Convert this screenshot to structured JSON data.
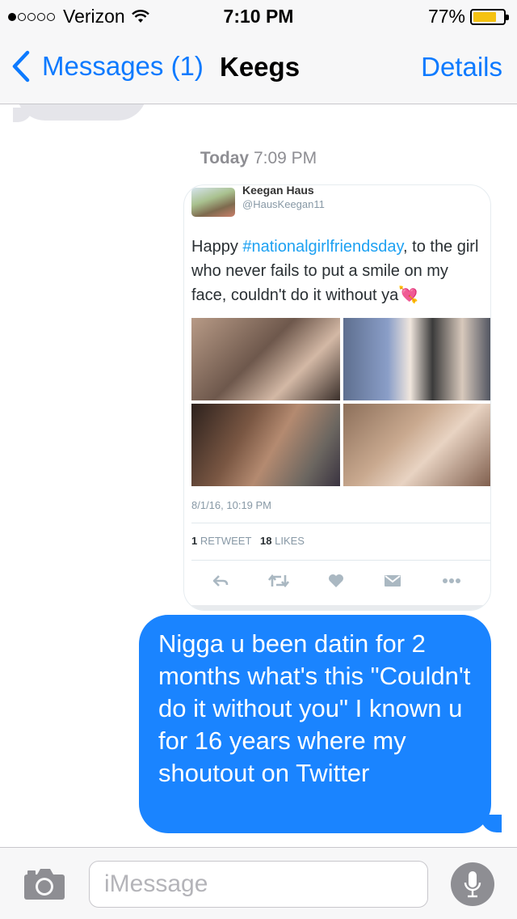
{
  "status_bar": {
    "signal_filled": 1,
    "signal_total": 5,
    "carrier": "Verizon",
    "time": "7:10 PM",
    "battery_percent": "77%",
    "battery_level": 0.77,
    "battery_color": "#f5c211"
  },
  "nav": {
    "back_label": "Messages (1)",
    "title": "Keegs",
    "details_label": "Details",
    "accent_color": "#0d7aff"
  },
  "conversation": {
    "timestamp_day": "Today",
    "timestamp_time": "7:09 PM",
    "tweet": {
      "name": "Keegan Haus",
      "handle": "@HausKeegan11",
      "text_before": "Happy ",
      "hashtag": "#nationalgirlfriendsday",
      "text_after": ", to the girl who never fails to put a smile on my face, couldn't do it without ya💘",
      "date": "8/1/16, 10:19 PM",
      "retweet_count": "1",
      "retweet_label": "RETWEET",
      "likes_count": "18",
      "likes_label": "LIKES",
      "actions": [
        "reply-icon",
        "retweet-icon",
        "heart-icon",
        "message-icon",
        "more-icon"
      ]
    },
    "sent_message": "Nigga u been datin for 2 months what's this \"Couldn't do it without you\" I known u for 16 years where my shoutout on Twitter",
    "sent_bubble_color": "#1a84ff"
  },
  "input_bar": {
    "placeholder": "iMessage",
    "icons": [
      "camera-icon",
      "microphone-icon"
    ]
  }
}
